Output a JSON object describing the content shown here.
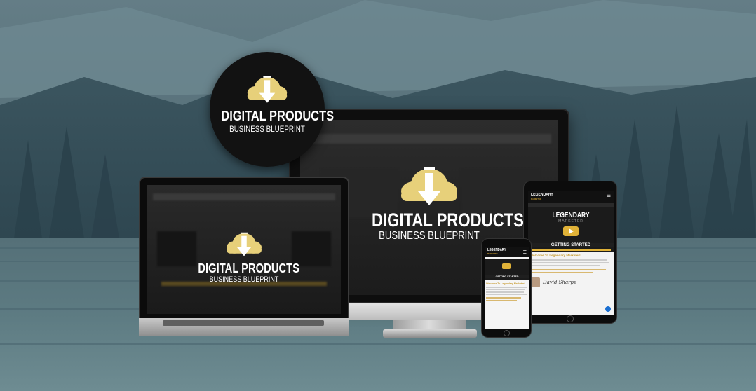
{
  "colors": {
    "brand_gold": "#e7d07a",
    "dark": "#121212",
    "accent_link": "#c69a2e"
  },
  "icons": {
    "cloud": "cloud-download-icon"
  },
  "badge": {
    "title": "DIGITAL PRODUCTS",
    "subtitle": "BUSINESS BLUEPRINT"
  },
  "monitor": {
    "title": "DIGITAL PRODUCTS",
    "subtitle": "BUSINESS BLUEPRINT"
  },
  "laptop": {
    "title": "DIGITAL PRODUCTS",
    "subtitle": "BUSINESS BLUEPRINT"
  },
  "tablet": {
    "brand": "LEGENDARY",
    "brand_sub": "MARKETER",
    "hero_title": "LEGENDARY",
    "hero_sub": "MARKETER",
    "bar": "GETTING STARTED",
    "welcome": "Welcome To Legendary Marketer!",
    "signature": "David Sharpe"
  },
  "phone": {
    "brand": "LEGENDARY",
    "brand_sub": "MARKETER",
    "bar": "GETTING STARTED",
    "welcome": "Welcome To Legendary Marketer!"
  }
}
